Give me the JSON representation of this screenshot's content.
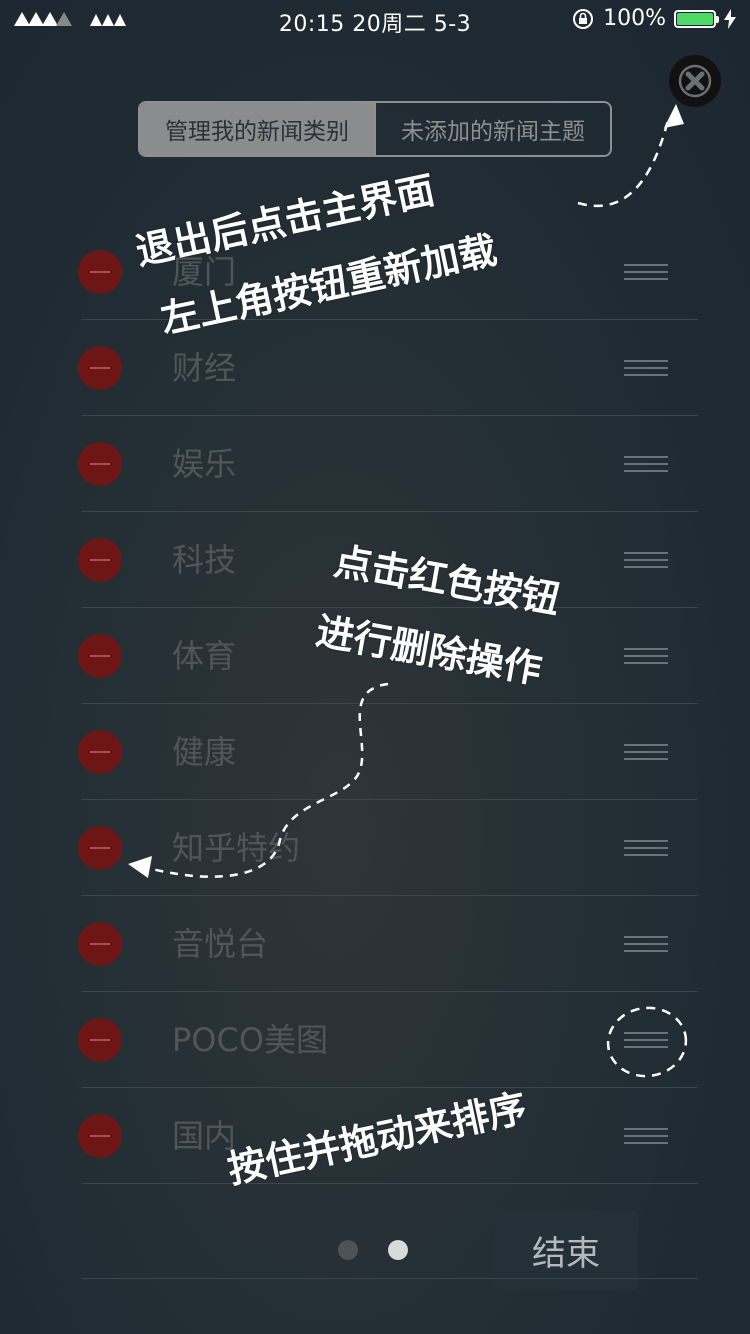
{
  "status_bar": {
    "time": "20:15 20周二 5-3",
    "battery_percent": "100%",
    "battery_level": 1.0
  },
  "segment": {
    "tabs": [
      {
        "label": "管理我的新闻类别",
        "active": true
      },
      {
        "label": "未添加的新闻主题",
        "active": false
      }
    ]
  },
  "categories": [
    {
      "label": "厦门"
    },
    {
      "label": "财经"
    },
    {
      "label": "娱乐"
    },
    {
      "label": "科技"
    },
    {
      "label": "体育"
    },
    {
      "label": "健康"
    },
    {
      "label": "知乎特约"
    },
    {
      "label": "音悦台"
    },
    {
      "label": "POCO美图"
    },
    {
      "label": "国内"
    }
  ],
  "footer": {
    "finish_label": "结束",
    "page_count": 2,
    "current_page": 2
  },
  "hints": {
    "reload_line1": "退出后点击主界面",
    "reload_line2": "左上角按钮重新加载",
    "delete_line1": "点击红色按钮",
    "delete_line2": "进行删除操作",
    "sort": "按住并拖动来排序"
  },
  "colors": {
    "delete_button": "#6e1516",
    "active_dot": "#d8dadb",
    "battery_fill": "#4cd964"
  }
}
